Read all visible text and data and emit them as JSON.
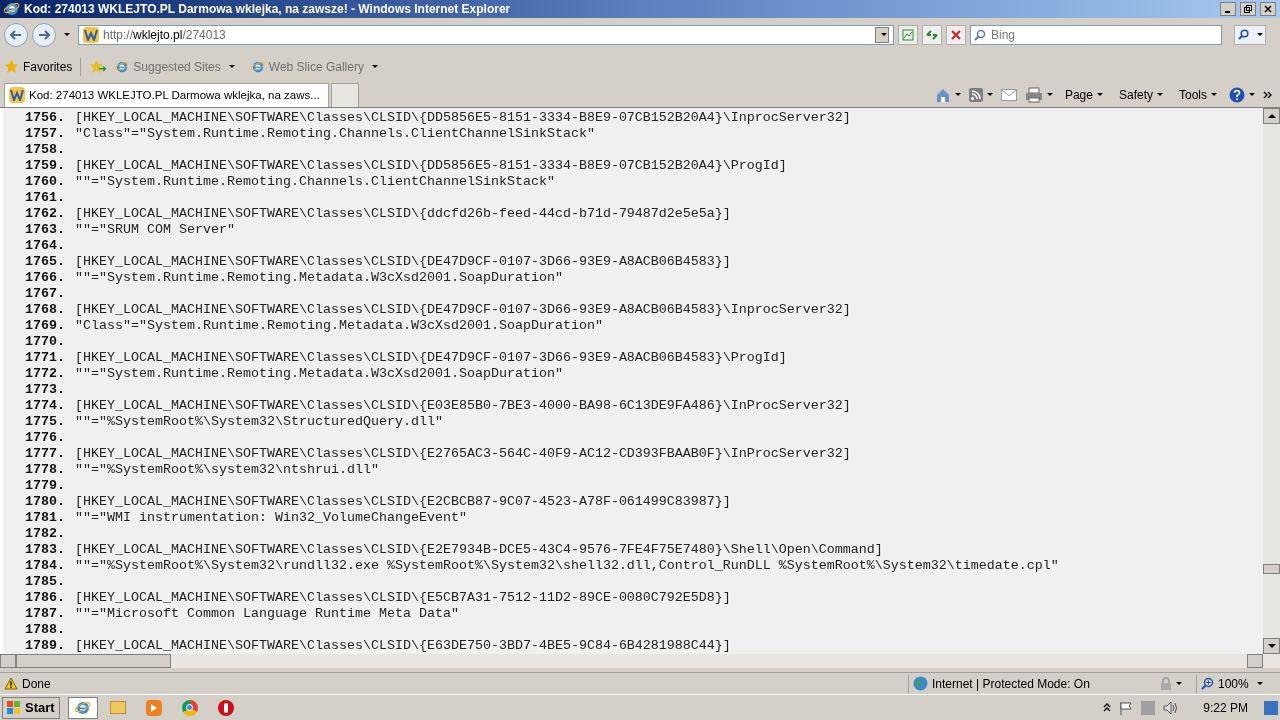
{
  "window": {
    "title": "Kod: 274013 WKLEJTO.PL Darmowa wklejka, na zawsze! - Windows Internet Explorer"
  },
  "address": {
    "prefix": "http://",
    "domain": "wklejto.pl",
    "path": "/274013"
  },
  "search": {
    "placeholder": "Bing"
  },
  "favorites_bar": {
    "favorites": "Favorites",
    "items": [
      "Suggested Sites",
      "Web Slice Gallery"
    ]
  },
  "tabs": [
    {
      "label": "Kod: 274013 WKLEJTO.PL Darmowa wklejka, na zaws...",
      "selected": true
    }
  ],
  "command_bar": [
    "Page",
    "Safety",
    "Tools"
  ],
  "code_lines": [
    {
      "number": "1756.",
      "text": "[HKEY_LOCAL_MACHINE\\SOFTWARE\\Classes\\CLSID\\{DD5856E5-8151-3334-B8E9-07CB152B20A4}\\InprocServer32]"
    },
    {
      "number": "1757.",
      "text": "\"Class\"=\"System.Runtime.Remoting.Channels.ClientChannelSinkStack\""
    },
    {
      "number": "1758."
    },
    {
      "number": "1759.",
      "text": "[HKEY_LOCAL_MACHINE\\SOFTWARE\\Classes\\CLSID\\{DD5856E5-8151-3334-B8E9-07CB152B20A4}\\ProgId]"
    },
    {
      "number": "1760.",
      "text": "\"\"=\"System.Runtime.Remoting.Channels.ClientChannelSinkStack\""
    },
    {
      "number": "1761."
    },
    {
      "number": "1762.",
      "text": "[HKEY_LOCAL_MACHINE\\SOFTWARE\\Classes\\CLSID\\{ddcfd26b-feed-44cd-b71d-79487d2e5e5a}]"
    },
    {
      "number": "1763.",
      "text": "\"\"=\"SRUM COM Server\""
    },
    {
      "number": "1764."
    },
    {
      "number": "1765.",
      "text": "[HKEY_LOCAL_MACHINE\\SOFTWARE\\Classes\\CLSID\\{DE47D9CF-0107-3D66-93E9-A8ACB06B4583}]"
    },
    {
      "number": "1766.",
      "text": "\"\"=\"System.Runtime.Remoting.Metadata.W3cXsd2001.SoapDuration\""
    },
    {
      "number": "1767."
    },
    {
      "number": "1768.",
      "text": "[HKEY_LOCAL_MACHINE\\SOFTWARE\\Classes\\CLSID\\{DE47D9CF-0107-3D66-93E9-A8ACB06B4583}\\InprocServer32]"
    },
    {
      "number": "1769.",
      "text": "\"Class\"=\"System.Runtime.Remoting.Metadata.W3cXsd2001.SoapDuration\""
    },
    {
      "number": "1770."
    },
    {
      "number": "1771.",
      "text": "[HKEY_LOCAL_MACHINE\\SOFTWARE\\Classes\\CLSID\\{DE47D9CF-0107-3D66-93E9-A8ACB06B4583}\\ProgId]"
    },
    {
      "number": "1772.",
      "text": "\"\"=\"System.Runtime.Remoting.Metadata.W3cXsd2001.SoapDuration\""
    },
    {
      "number": "1773."
    },
    {
      "number": "1774.",
      "text": "[HKEY_LOCAL_MACHINE\\SOFTWARE\\Classes\\CLSID\\{E03E85B0-7BE3-4000-BA98-6C13DE9FA486}\\InProcServer32]"
    },
    {
      "number": "1775.",
      "text": "\"\"=\"%SystemRoot%\\System32\\StructuredQuery.dll\""
    },
    {
      "number": "1776."
    },
    {
      "number": "1777.",
      "text": "[HKEY_LOCAL_MACHINE\\SOFTWARE\\Classes\\CLSID\\{E2765AC3-564C-40F9-AC12-CD393FBAAB0F}\\InProcServer32]"
    },
    {
      "number": "1778.",
      "text": "\"\"=\"%SystemRoot%\\system32\\ntshrui.dll\""
    },
    {
      "number": "1779."
    },
    {
      "number": "1780.",
      "text": "[HKEY_LOCAL_MACHINE\\SOFTWARE\\Classes\\CLSID\\{E2CBCB87-9C07-4523-A78F-061499C83987}]"
    },
    {
      "number": "1781.",
      "text": "\"\"=\"WMI instrumentation: Win32_VolumeChangeEvent\""
    },
    {
      "number": "1782."
    },
    {
      "number": "1783.",
      "text": "[HKEY_LOCAL_MACHINE\\SOFTWARE\\Classes\\CLSID\\{E2E7934B-DCE5-43C4-9576-7FE4F75E7480}\\Shell\\Open\\Command]"
    },
    {
      "number": "1784.",
      "text": "\"\"=\"%SystemRoot%\\System32\\rundll32.exe %SystemRoot%\\System32\\shell32.dll,Control_RunDLL %SystemRoot%\\System32\\timedate.cpl\""
    },
    {
      "number": "1785."
    },
    {
      "number": "1786.",
      "text": "[HKEY_LOCAL_MACHINE\\SOFTWARE\\Classes\\CLSID\\{E5CB7A31-7512-11D2-89CE-0080C792E5D8}]"
    },
    {
      "number": "1787.",
      "text": "\"\"=\"Microsoft Common Language Runtime Meta Data\""
    },
    {
      "number": "1788."
    },
    {
      "number": "1789.",
      "text": "[HKEY_LOCAL_MACHINE\\SOFTWARE\\Classes\\CLSID\\{E63DE750-3BD7-4BE5-9C84-6B4281988C44}]"
    }
  ],
  "status_bar": {
    "status": "Done",
    "zone": "Internet | Protected Mode: On",
    "zoom": "100%"
  },
  "taskbar": {
    "start": "Start",
    "clock": "9:22 PM"
  }
}
